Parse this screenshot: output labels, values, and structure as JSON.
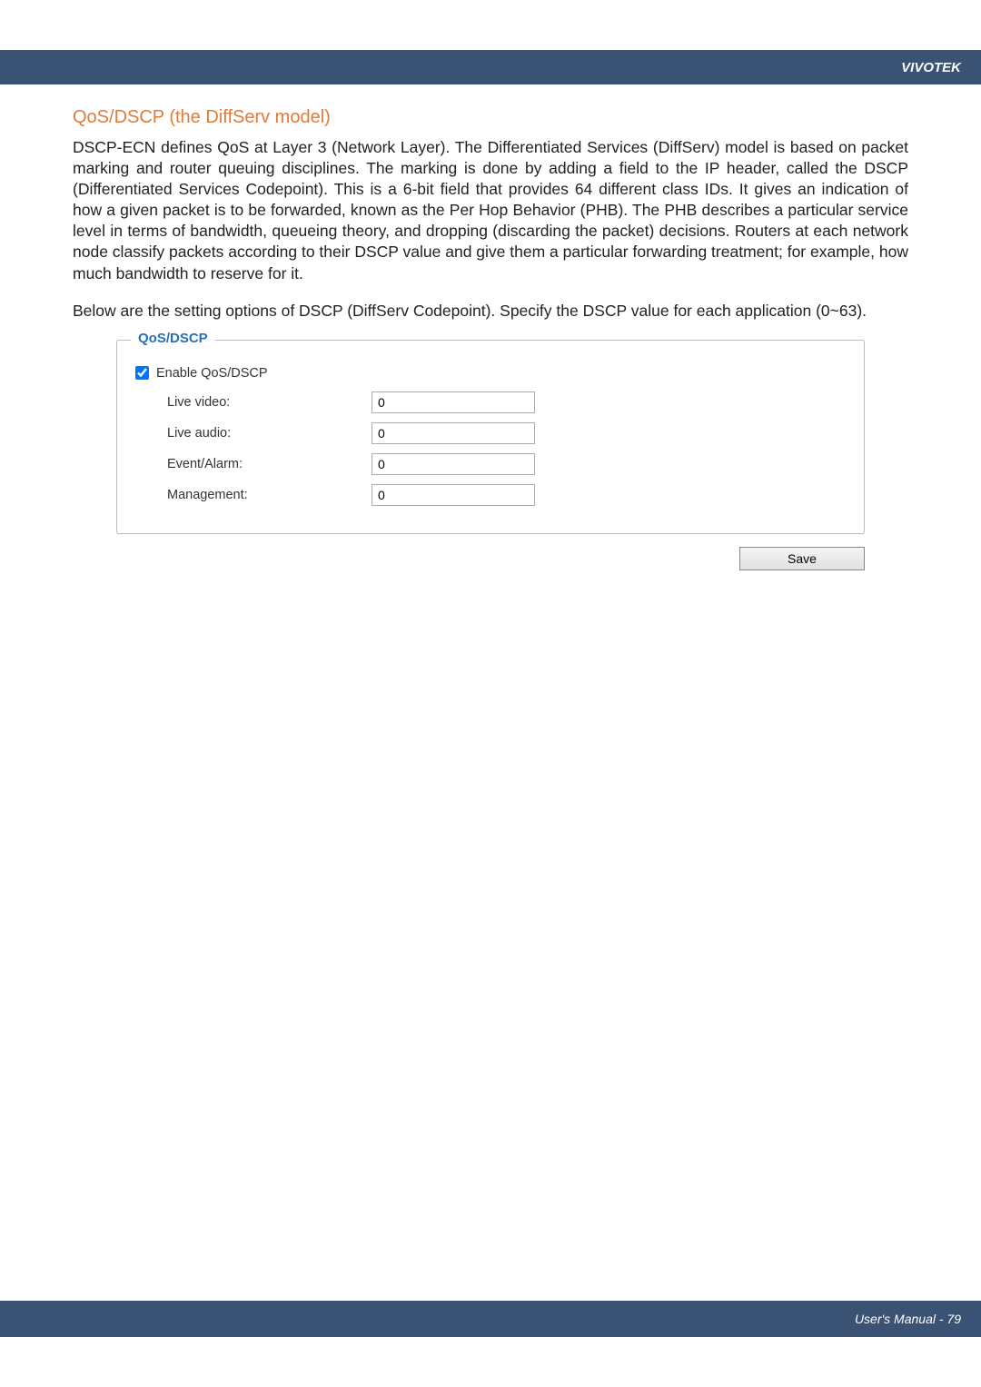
{
  "header": {
    "brand": "VIVOTEK"
  },
  "section": {
    "title": "QoS/DSCP (the DiffServ model)",
    "paragraph1": "DSCP-ECN defines QoS at Layer 3 (Network Layer). The Differentiated Services (DiffServ) model is based on packet marking and router queuing disciplines. The marking is done by adding a field to the IP header, called the DSCP (Differentiated Services Codepoint). This is a 6-bit field that provides 64 different class IDs. It gives an indication of how a given packet is to be forwarded, known as the Per Hop Behavior (PHB). The PHB describes a particular service level in terms of bandwidth, queueing theory, and dropping (discarding the packet) decisions. Routers at each network node classify packets according to their DSCP value and give them a particular forwarding treatment; for example, how much bandwidth to reserve for it.",
    "paragraph2": "Below are the setting options of DSCP (DiffServ Codepoint). Specify the DSCP value for each application (0~63)."
  },
  "panel": {
    "legend": "QoS/DSCP",
    "enable_label": "Enable QoS/DSCP",
    "fields": {
      "live_video": {
        "label": "Live video:",
        "value": "0"
      },
      "live_audio": {
        "label": "Live audio:",
        "value": "0"
      },
      "event_alarm": {
        "label": "Event/Alarm:",
        "value": "0"
      },
      "management": {
        "label": "Management:",
        "value": "0"
      }
    },
    "save_label": "Save"
  },
  "footer": {
    "text": "User's Manual - 79"
  }
}
